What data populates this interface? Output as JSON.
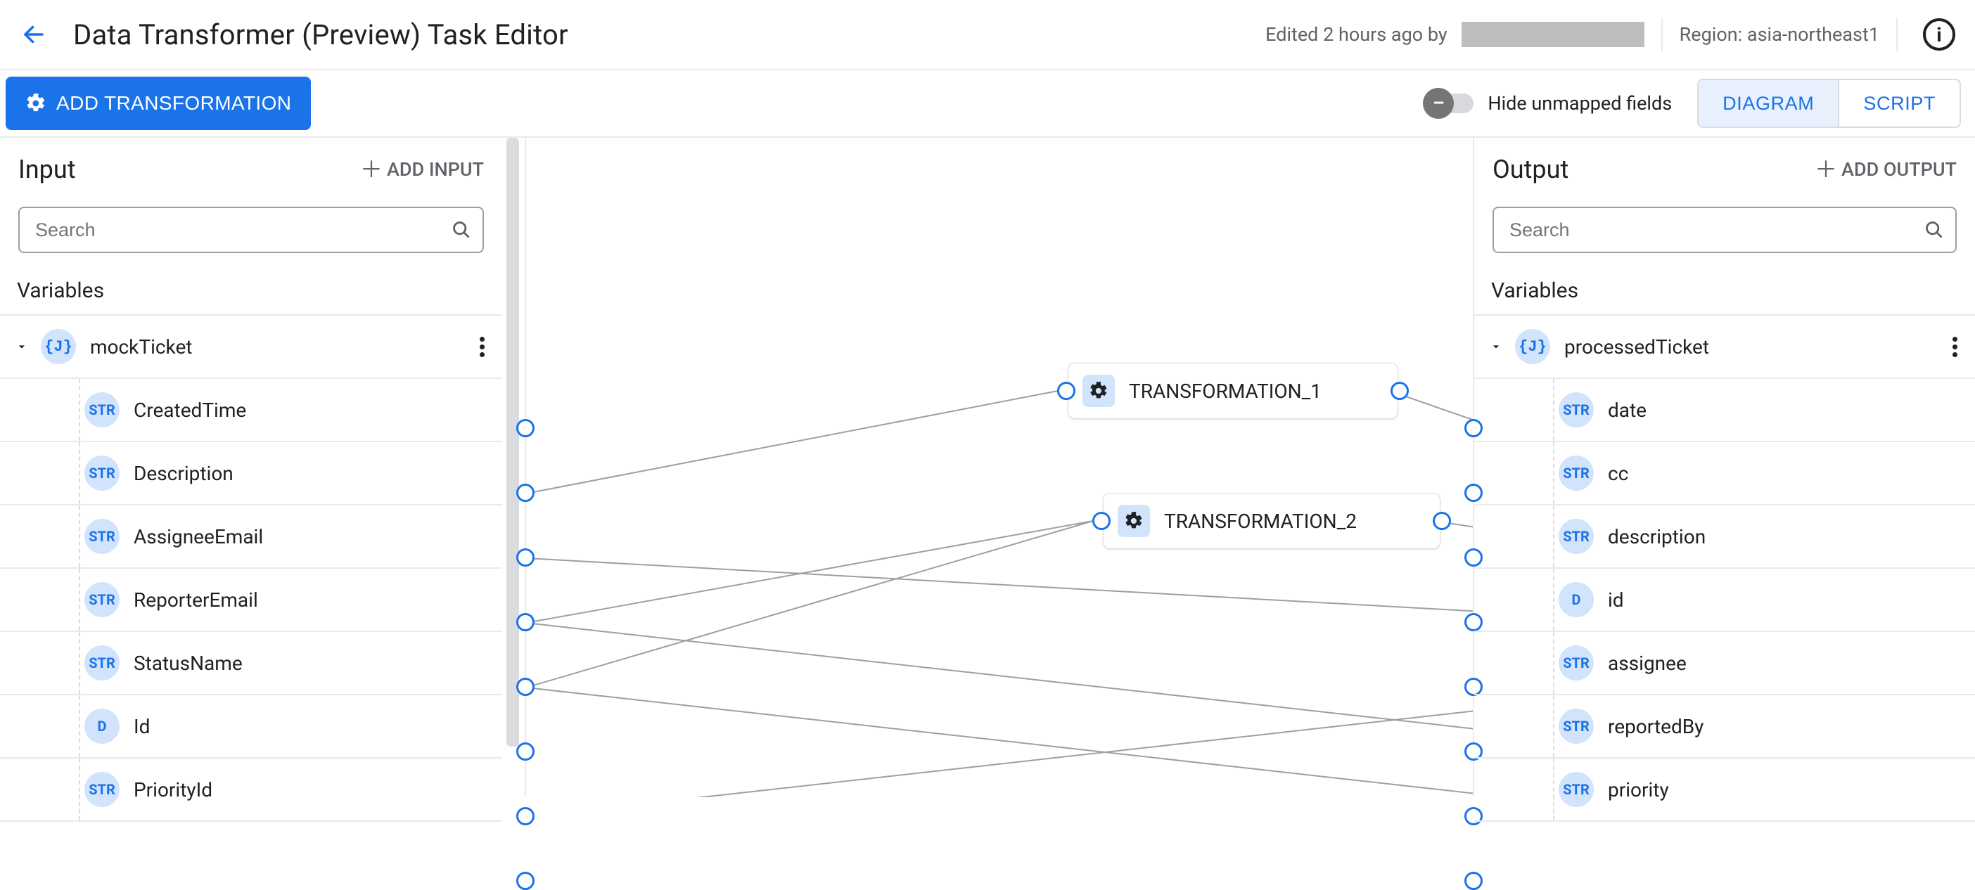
{
  "header": {
    "title": "Data Transformer (Preview) Task Editor",
    "edited_label": "Edited 2 hours ago by ",
    "region_label": "Region: asia-northeast1"
  },
  "toolbar": {
    "add_transformation_label": "ADD TRANSFORMATION",
    "hide_unmapped_label": "Hide unmapped fields",
    "diagram_label": "DIAGRAM",
    "script_label": "SCRIPT"
  },
  "input_panel": {
    "title": "Input",
    "add_label": "ADD INPUT",
    "search_placeholder": "Search",
    "variables_label": "Variables",
    "root": {
      "type": "{J}",
      "name": "mockTicket"
    },
    "fields": [
      {
        "type": "STR",
        "name": "CreatedTime"
      },
      {
        "type": "STR",
        "name": "Description"
      },
      {
        "type": "STR",
        "name": "AssigneeEmail"
      },
      {
        "type": "STR",
        "name": "ReporterEmail"
      },
      {
        "type": "STR",
        "name": "StatusName"
      },
      {
        "type": "D",
        "name": "Id"
      },
      {
        "type": "STR",
        "name": "PriorityId"
      }
    ]
  },
  "output_panel": {
    "title": "Output",
    "add_label": "ADD OUTPUT",
    "search_placeholder": "Search",
    "variables_label": "Variables",
    "root": {
      "type": "{J}",
      "name": "processedTicket"
    },
    "fields": [
      {
        "type": "STR",
        "name": "date"
      },
      {
        "type": "STR",
        "name": "cc"
      },
      {
        "type": "STR",
        "name": "description"
      },
      {
        "type": "D",
        "name": "id"
      },
      {
        "type": "STR",
        "name": "assignee"
      },
      {
        "type": "STR",
        "name": "reportedBy"
      },
      {
        "type": "STR",
        "name": "priority"
      }
    ]
  },
  "nodes": {
    "t1": "TRANSFORMATION_1",
    "t2": "TRANSFORMATION_2"
  }
}
